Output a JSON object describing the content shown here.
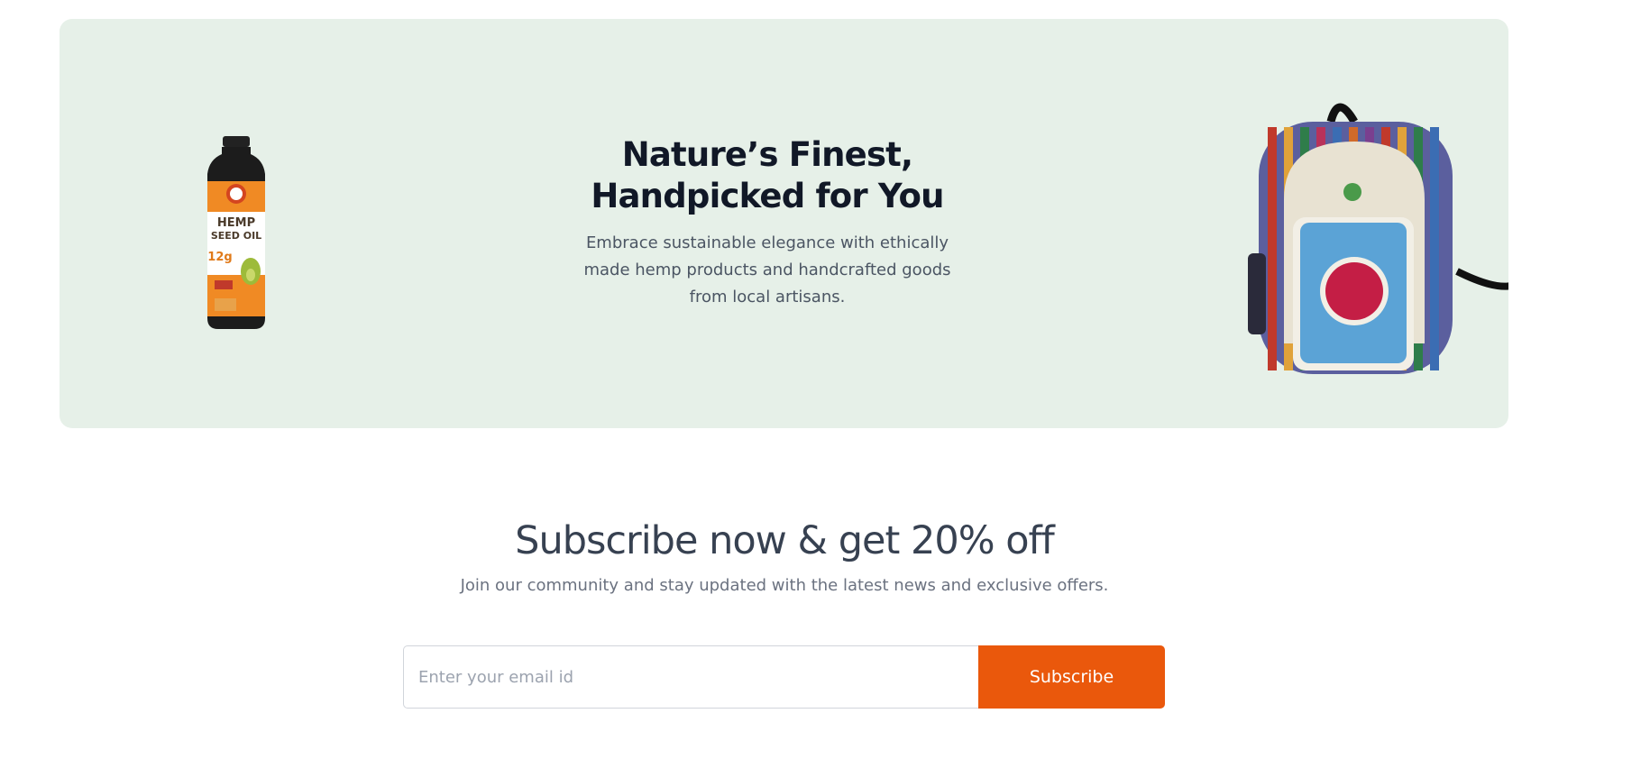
{
  "banner": {
    "title": "Nature’s Finest, Handpicked for You",
    "subtitle": "Embrace sustainable elegance with ethically made hemp products and handcrafted goods from local artisans.",
    "background_color": "#e6f0e8",
    "left_product": {
      "icon": "hemp-seed-oil-bottle-image",
      "label_brand": "HEMP",
      "label_name": "SEED OIL",
      "label_value": "12g"
    },
    "right_product": {
      "icon": "hemp-backpack-image"
    }
  },
  "subscribe": {
    "title": "Subscribe now & get 20% off",
    "description": "Join our community and stay updated with the latest news and exclusive offers.",
    "email_placeholder": "Enter your email id",
    "button_label": "Subscribe",
    "button_color": "#ea580c"
  }
}
